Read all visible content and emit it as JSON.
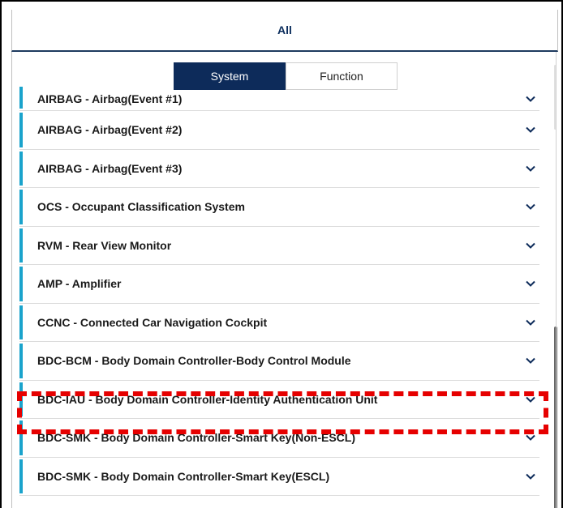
{
  "header": {
    "title": "All"
  },
  "tabs": [
    {
      "label": "System",
      "active": true
    },
    {
      "label": "Function",
      "active": false
    }
  ],
  "items": [
    {
      "label": "AIRBAG - Airbag(Event #1)"
    },
    {
      "label": "AIRBAG - Airbag(Event #2)"
    },
    {
      "label": "AIRBAG - Airbag(Event #3)"
    },
    {
      "label": "OCS - Occupant Classification System"
    },
    {
      "label": "RVM - Rear View Monitor"
    },
    {
      "label": "AMP - Amplifier"
    },
    {
      "label": "CCNC - Connected Car Navigation Cockpit"
    },
    {
      "label": "BDC-BCM - Body Domain Controller-Body Control Module"
    },
    {
      "label": "BDC-IAU - Body Domain Controller-Identity Authentication Unit"
    },
    {
      "label": "BDC-SMK - Body Domain Controller-Smart Key(Non-ESCL)"
    },
    {
      "label": "BDC-SMK - Body Domain Controller-Smart Key(ESCL)"
    }
  ],
  "colors": {
    "accent": "#1aa3cc",
    "primary": "#0d2b5a",
    "highlight": "#e60000"
  },
  "icons": {
    "expand": "chevron-down-icon"
  }
}
